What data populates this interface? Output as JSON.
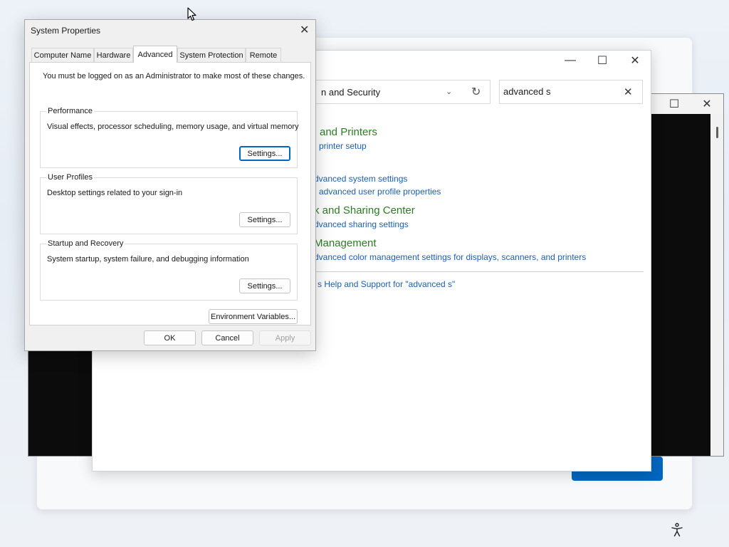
{
  "control_panel": {
    "address_text": "n and Security",
    "search_value": "advanced s",
    "results": [
      {
        "heading": "and Printers",
        "links": [
          "printer setup"
        ]
      },
      {
        "heading": "",
        "links": [
          "dvanced system settings",
          "advanced user profile properties"
        ]
      },
      {
        "heading": "k and Sharing Center",
        "links": [
          "dvanced sharing settings"
        ]
      },
      {
        "heading": "Management",
        "links": [
          "dvanced color management settings for displays, scanners, and printers"
        ]
      }
    ],
    "help_link": "s Help and Support for \"advanced s\""
  },
  "system_properties": {
    "title": "System Properties",
    "tabs": [
      {
        "label": "Computer Name",
        "active": false
      },
      {
        "label": "Hardware",
        "active": false
      },
      {
        "label": "Advanced",
        "active": true
      },
      {
        "label": "System Protection",
        "active": false
      },
      {
        "label": "Remote",
        "active": false
      }
    ],
    "admin_note": "You must be logged on as an Administrator to make most of these changes.",
    "groups": [
      {
        "title": "Performance",
        "description": "Visual effects, processor scheduling, memory usage, and virtual memory",
        "button": "Settings..."
      },
      {
        "title": "User Profiles",
        "description": "Desktop settings related to your sign-in",
        "button": "Settings..."
      },
      {
        "title": "Startup and Recovery",
        "description": "System startup, system failure, and debugging information",
        "button": "Settings..."
      }
    ],
    "env_button": "Environment Variables...",
    "ok_button": "OK",
    "cancel_button": "Cancel",
    "apply_button": "Apply"
  },
  "icons": {
    "minimize": "minimize-icon",
    "maximize": "maximize-icon",
    "close": "close-icon",
    "chevron": "chevron-down-icon",
    "refresh": "refresh-icon",
    "clear": "clear-icon",
    "cursor": "mouse-cursor-icon",
    "accessibility": "accessibility-icon"
  },
  "colors": {
    "accent": "#0067c0",
    "cp_heading": "#2a7d22",
    "cp_link": "#1a5fb4"
  }
}
